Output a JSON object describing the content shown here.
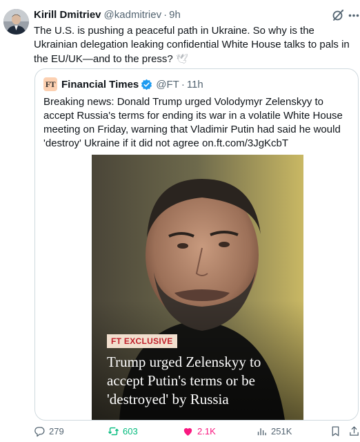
{
  "tweet": {
    "author_name": "Kirill Dmitriev",
    "author_handle": "@kadmitriev",
    "separator": "·",
    "time": "9h",
    "text": "The U.S. is pushing a peaceful path in Ukraine. So why is the Ukrainian delegation leaking confidential White House talks to pals in the EU/UK—and to the press?",
    "emoji": "🕊",
    "icons": {
      "avatar": "profile-photo",
      "grok": "grok-icon",
      "more": "more-icon"
    }
  },
  "quote": {
    "logo_text": "FT",
    "author_name": "Financial Times",
    "author_handle": "@FT",
    "separator": "·",
    "time": "11h",
    "text": "Breaking news: Donald Trump urged Volodymyr Zelenskyy to accept Russia's terms for ending its war in a volatile White House meeting on Friday, warning that Vladimir Putin had said he would 'destroy' Ukraine if it did not agree on.ft.com/3JgKcbT",
    "media": {
      "badge": "FT EXCLUSIVE",
      "headline": "Trump urged Zelenskyy to accept Putin's terms or be 'destroyed' by Russia"
    },
    "colors": {
      "logo_bg": "#fcd0b1",
      "badge_bg": "#f2dfce",
      "badge_text": "#c0202b",
      "verified": "#1d9bf0"
    }
  },
  "actions": {
    "replies": "279",
    "reposts": "603",
    "likes": "2.1K",
    "views": "251K",
    "colors": {
      "reposted": "#00ba7c",
      "liked": "#f91880",
      "default": "#536471"
    }
  }
}
